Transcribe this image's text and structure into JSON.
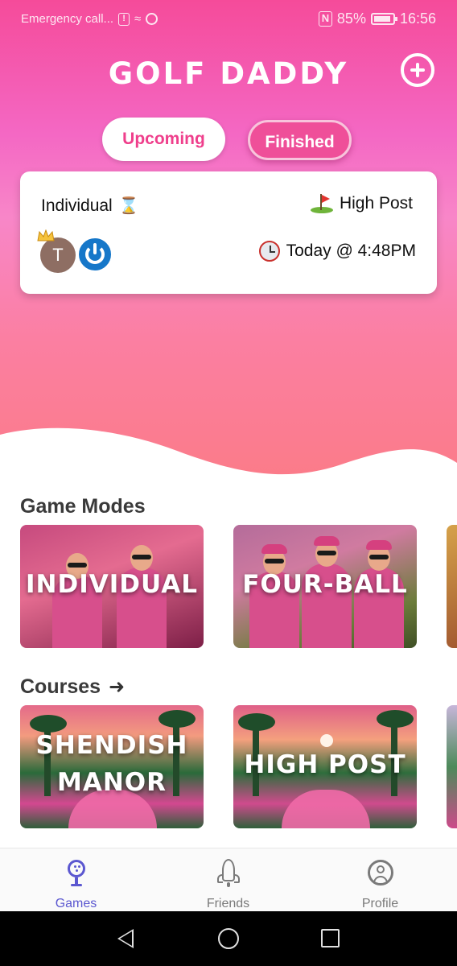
{
  "status_bar": {
    "carrier_text": "Emergency call...",
    "nfc": "N",
    "battery": "85%",
    "time": "16:56"
  },
  "header": {
    "title": "GOLF DADDY",
    "add_icon": "plus-circle-icon"
  },
  "tabs": [
    {
      "label": "Upcoming",
      "active": true
    },
    {
      "label": "Finished",
      "active": false
    }
  ],
  "game_card": {
    "type": "Individual",
    "type_icon": "hourglass-icon",
    "course": "High Post",
    "course_icon": "golf-flag-icon",
    "time": "Today @ 4:48PM",
    "time_icon": "alarm-clock-icon",
    "players": [
      {
        "initial": "T",
        "crown": true
      },
      {
        "icon": "power-icon"
      }
    ]
  },
  "game_modes": {
    "title": "Game Modes",
    "items": [
      "INDIVIDUAL",
      "FOUR-BALL"
    ]
  },
  "courses": {
    "title": "Courses",
    "arrow_icon": "arrow-right-icon",
    "items": [
      {
        "line1": "SHENDISH",
        "line2": "MANOR"
      },
      {
        "line1": "HIGH POST"
      }
    ]
  },
  "bottom_nav": [
    {
      "label": "Games",
      "icon": "golf-ball-icon",
      "active": true,
      "color": "#5b57d0"
    },
    {
      "label": "Friends",
      "icon": "rocket-icon",
      "active": false,
      "color": "#7a7a7a"
    },
    {
      "label": "Profile",
      "icon": "user-circle-icon",
      "active": false,
      "color": "#7a7a7a"
    }
  ],
  "colors": {
    "accent_pink": "#ef3f8c",
    "hero_top": "#f54b9a",
    "hero_bottom": "#fb7b88"
  }
}
